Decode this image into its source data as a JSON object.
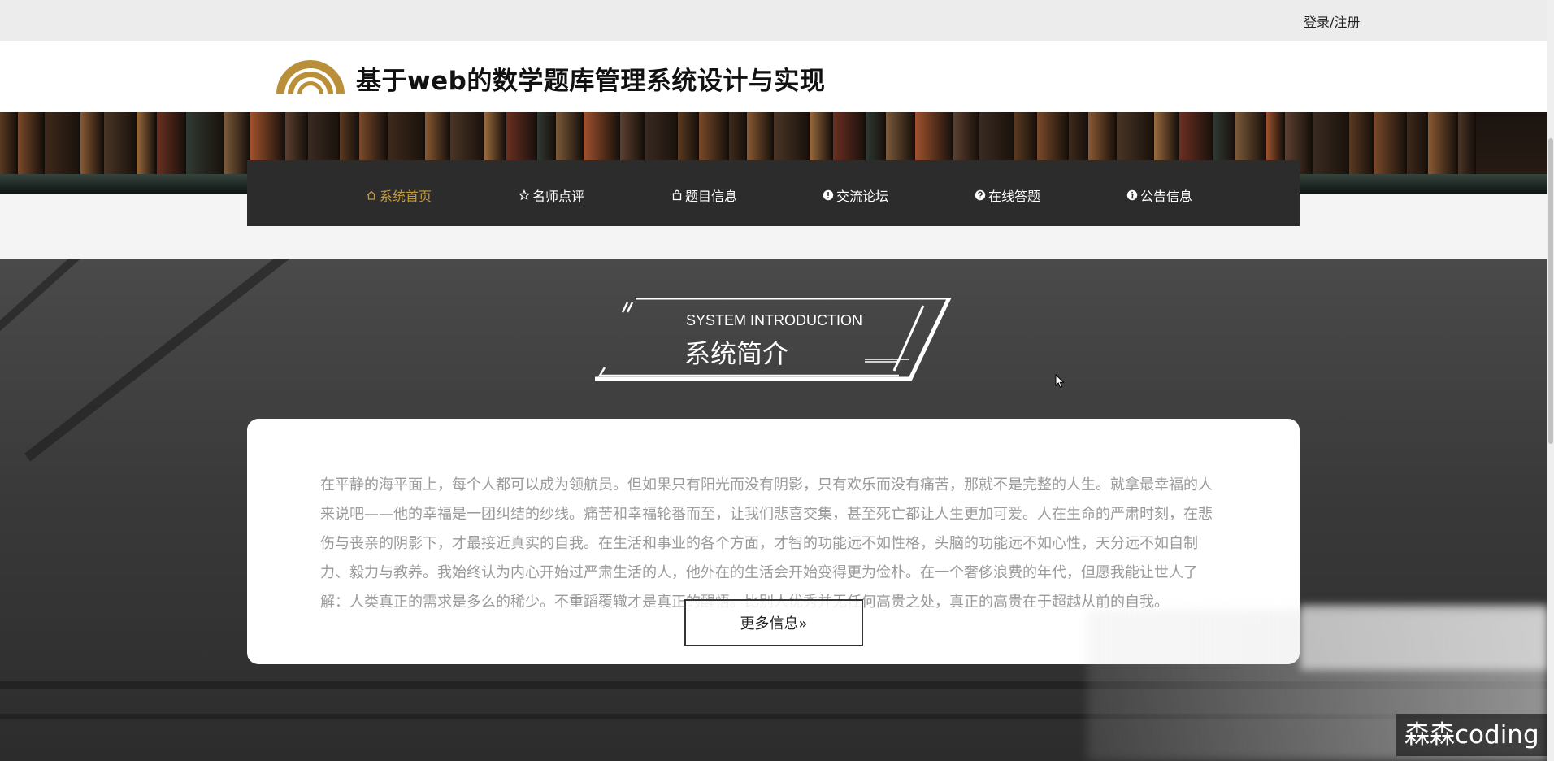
{
  "topbar": {
    "login_label": "登录/注册"
  },
  "header": {
    "title": "基于web的数学题库管理系统设计与实现"
  },
  "nav": {
    "items": [
      {
        "label": "系统首页",
        "icon": "home-icon",
        "active": true
      },
      {
        "label": "名师点评",
        "icon": "star-icon",
        "active": false
      },
      {
        "label": "题目信息",
        "icon": "bag-icon",
        "active": false
      },
      {
        "label": "交流论坛",
        "icon": "exclamation-circle-icon",
        "active": false
      },
      {
        "label": "在线答题",
        "icon": "question-circle-icon",
        "active": false
      },
      {
        "label": "公告信息",
        "icon": "info-circle-icon",
        "active": false
      }
    ]
  },
  "intro": {
    "subtitle_en": "SYSTEM INTRODUCTION",
    "title_cn": "系统简介",
    "text": "在平静的海平面上，每个人都可以成为领航员。但如果只有阳光而没有阴影，只有欢乐而没有痛苦，那就不是完整的人生。就拿最幸福的人来说吧——他的幸福是一团纠结的纱线。痛苦和幸福轮番而至，让我们悲喜交集，甚至死亡都让人生更加可爱。人在生命的严肃时刻，在悲伤与丧亲的阴影下，才最接近真实的自我。在生活和事业的各个方面，才智的功能远不如性格，头脑的功能远不如心性，天分远不如自制力、毅力与教养。我始终认为内心开始过严肃生活的人，他外在的生活会开始变得更为俭朴。在一个奢侈浪费的年代，但愿我能让世人了解：人类真正的需求是多么的稀少。不重蹈覆辙才是真正的醒悟。比别人优秀并无任何高贵之处，真正的高贵在于超越从前的自我。",
    "more_label": "更多信息»"
  },
  "watermark": {
    "text": "森森coding"
  },
  "colors": {
    "accent": "#c49a3e",
    "nav_bg": "#2c2c2c",
    "text_muted": "#9a9a9a"
  }
}
